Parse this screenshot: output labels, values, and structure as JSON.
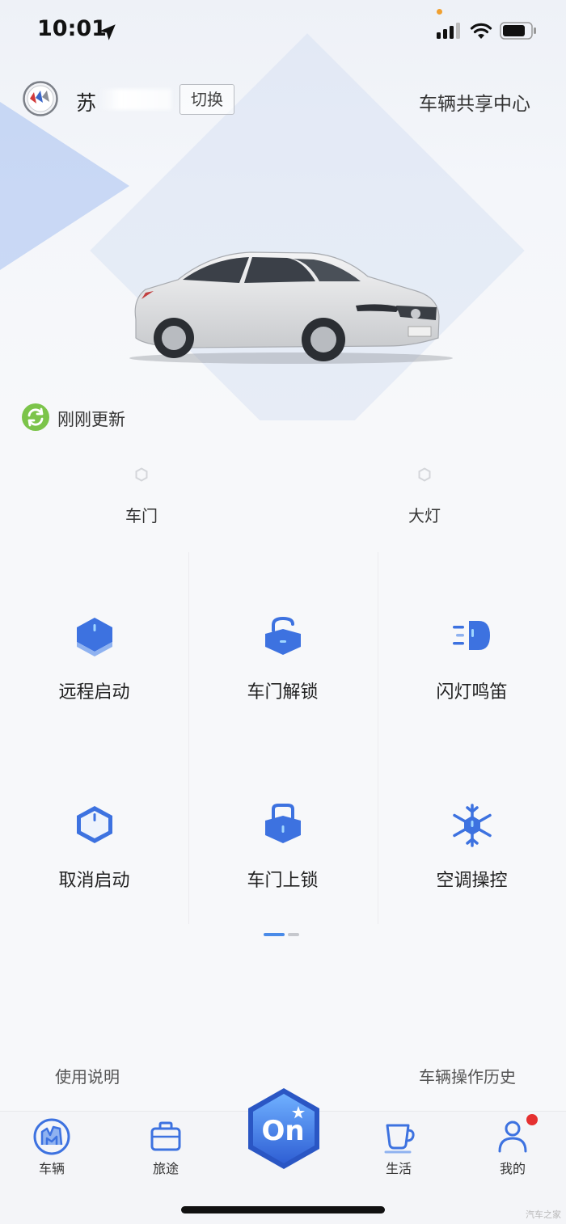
{
  "status_bar": {
    "time": "10:01"
  },
  "header": {
    "plate": "苏",
    "switch_label": "切换",
    "share_center": "车辆共享中心"
  },
  "refresh": {
    "text": "刚刚更新"
  },
  "vehicle_status": [
    {
      "label": "车门"
    },
    {
      "label": "大灯"
    }
  ],
  "controls": [
    {
      "label": "远程启动",
      "icon": "remote-start-icon"
    },
    {
      "label": "车门解锁",
      "icon": "unlock-icon"
    },
    {
      "label": "闪灯鸣笛",
      "icon": "headlight-horn-icon"
    },
    {
      "label": "取消启动",
      "icon": "cancel-start-icon"
    },
    {
      "label": "车门上锁",
      "icon": "lock-icon"
    },
    {
      "label": "空调操控",
      "icon": "ac-snowflake-icon"
    }
  ],
  "pager": {
    "current": 1,
    "total": 2
  },
  "footer_links": {
    "help": "使用说明",
    "history": "车辆操作历史"
  },
  "tabs": [
    {
      "label": "车辆",
      "icon": "vehicle-icon"
    },
    {
      "label": "旅途",
      "icon": "suitcase-icon"
    },
    {
      "label": "",
      "icon": "onstar-icon"
    },
    {
      "label": "生活",
      "icon": "cup-icon"
    },
    {
      "label": "我的",
      "icon": "person-icon"
    }
  ],
  "colors": {
    "accent": "#4a8be8",
    "icon_blue": "#3d72e0",
    "refresh_green": "#7cc44a",
    "notification": "#e53030"
  },
  "watermark": "汽车之家"
}
